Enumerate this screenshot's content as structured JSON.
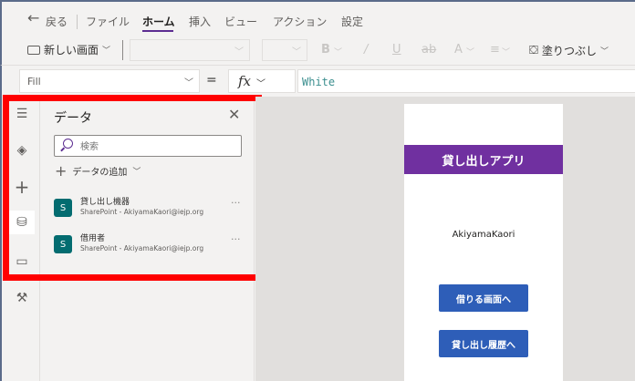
{
  "menu": {
    "back": "戻る",
    "file": "ファイル",
    "home": "ホーム",
    "insert": "挿入",
    "view": "ビュー",
    "action": "アクション",
    "settings": "設定"
  },
  "toolbar": {
    "new_screen": "新しい画面",
    "fill": "塗りつぶし"
  },
  "formula": {
    "property": "Fill",
    "equals": "=",
    "fx": "fx",
    "value": "White"
  },
  "panel": {
    "title": "データ",
    "search_placeholder": "検索",
    "add_data": "データの追加",
    "sources": [
      {
        "name": "貸し出し機器",
        "sub": "SharePoint - AkiyamaKaori@iejp.org",
        "icon": "S"
      },
      {
        "name": "借用者",
        "sub": "SharePoint - AkiyamaKaori@iejp.org",
        "icon": "S"
      }
    ]
  },
  "app": {
    "title": "貸し出しアプリ",
    "user": "AkiyamaKaori",
    "buttons": [
      "借りる画面へ",
      "貸し出し履歴へ"
    ],
    "header_color": "#7030a0",
    "button_color": "#2e5eb8"
  },
  "highlight_color": "#ff0000"
}
